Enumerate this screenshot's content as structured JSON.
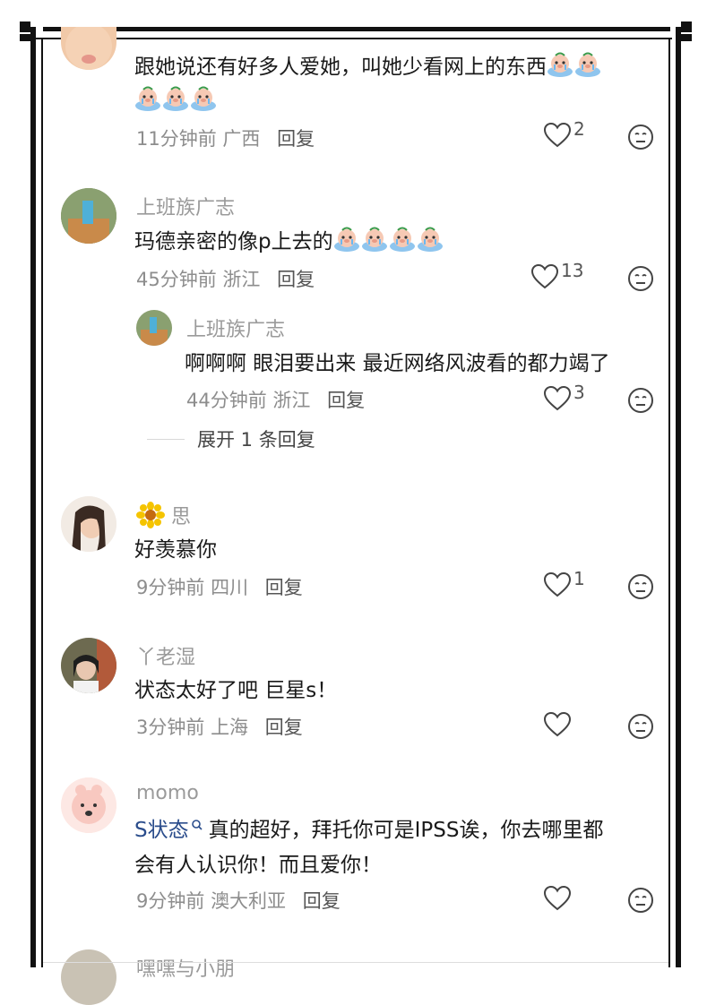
{
  "comments": [
    {
      "text1": "跟她说还有好多人爱她，叫她少看网上的东西",
      "time": "11分钟前",
      "location": "广西",
      "reply_label": "回复",
      "likes": "2"
    },
    {
      "username": "上班族广志",
      "text": "玛德亲密的像p上去的",
      "time": "45分钟前",
      "location": "浙江",
      "reply_label": "回复",
      "likes": "13",
      "reply": {
        "username": "上班族广志",
        "text": "啊啊啊 眼泪要出来 最近网络风波看的都力竭了",
        "time": "44分钟前",
        "location": "浙江",
        "reply_label": "回复",
        "likes": "3"
      },
      "expand_label": "展开 1 条回复"
    },
    {
      "username": "思",
      "text": "好羡慕你",
      "time": "9分钟前",
      "location": "四川",
      "reply_label": "回复",
      "likes": "1"
    },
    {
      "username": "丫老湿",
      "text": "状态太好了吧 巨星s！",
      "time": "3分钟前",
      "location": "上海",
      "reply_label": "回复"
    },
    {
      "username": "momo",
      "mention": "S状态",
      "text1": "真的超好，拜托你可是IPSS诶，你去哪里都",
      "text2": "会有人认识你！而且爱你！",
      "time": "9分钟前",
      "location": "澳大利亚",
      "reply_label": "回复"
    },
    {
      "username": "嘿嘿与小朋"
    }
  ],
  "icons": {
    "like": "heart-outline-icon",
    "dislike": "meh-face-icon",
    "emoji": "crying-pig-emoji",
    "flower": "sunflower-icon",
    "search_mark": "search-icon"
  },
  "colors": {
    "mention": "#2b4d8c",
    "meta": "#8d8d8d",
    "username": "#9a9a9a"
  }
}
